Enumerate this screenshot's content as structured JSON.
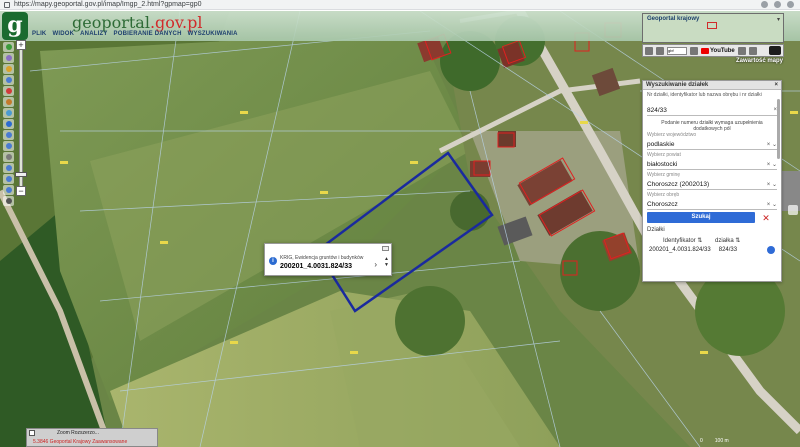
{
  "browser": {
    "url": "https://mapy.geoportal.gov.pl/imap/Imgp_2.html?gpmap=gp0"
  },
  "app": {
    "logo_letter": "g",
    "logo_word_main": "geoportal",
    "logo_word_domain": ".gov.pl",
    "menu": [
      "PLIK",
      "WIDOK",
      "ANALIZY",
      "POBIERANIE DANYCH",
      "WYSZUKIWANIA"
    ]
  },
  "toolbar": {
    "icons": [
      "home-icon",
      "layers-icon",
      "legend-icon",
      "print-icon",
      "flag-icon",
      "draw-icon",
      "measure-icon",
      "info-icon",
      "zoom-in-icon",
      "zoom-out-icon",
      "pan-icon",
      "back-icon",
      "forward-icon",
      "fullscreen-icon",
      "locate-icon"
    ],
    "colors": [
      "#3a9b3a",
      "#8a6fc2",
      "#d9a22b",
      "#4a7bd1",
      "#d13a3a",
      "#c47a2b",
      "#4a9bd1",
      "#2b6bd1",
      "#4a7bd1",
      "#4a7bd1",
      "#7a7a7a",
      "#4a7bd1",
      "#4a7bd1",
      "#4a7bd1",
      "#555555"
    ]
  },
  "popup": {
    "layer": "KRIG, Ewidencja gruntów i budynków",
    "plot_id": "200201_4.0031.824/33",
    "arrow": "›",
    "up": "▲",
    "down": "▼"
  },
  "minimap": {
    "title": "Geoportal krajowy",
    "close": "▾",
    "youtube_label": "YouTube",
    "select_value": "gbf",
    "contents_label": "Zawartość mapy"
  },
  "search_panel": {
    "title": "Wyszukiwanie działek",
    "close": "×",
    "hint": "Nr działki, identyfikator lub nazwa obrębu i nr działki",
    "query_value": "824/33",
    "query_clear": "×",
    "message": "Podanie numeru działki wymaga uzupełnienia dodatkowych pól",
    "voivodeship_label": "Wybierz województwo",
    "voivodeship_value": "podlaskie",
    "county_label": "Wybierz powiat",
    "county_value": "białostocki",
    "commune_label": "Wybierz gminę",
    "commune_value": "Choroszcz (2002013)",
    "precinct_label": "Wybierz obręb",
    "precinct_value": "Choroszcz",
    "dropdown_icons": "× ⌄",
    "search_button": "Szukaj",
    "clear_button": "✕",
    "results_title": "Działki",
    "col_identifier": "Identyfikator",
    "col_plot": "działka",
    "sort_icon": "⇅",
    "result_id": "200201_4.0031.824/33",
    "result_plot": "824/33"
  },
  "overview": {
    "line1": "Zoom  Rozszerzo...",
    "line2": "5.3846   Geoportal Krajowy  Zaawansowane"
  },
  "scale": {
    "left": "0",
    "right": "100 m"
  }
}
